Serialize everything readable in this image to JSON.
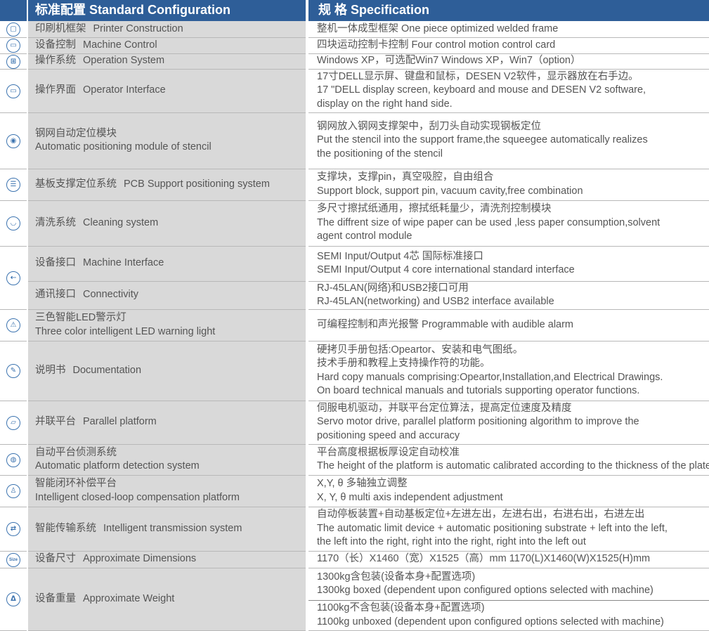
{
  "header": {
    "left": "标准配置  Standard Configuration",
    "right": "规  格  Specification"
  },
  "rows": [
    {
      "icon": "frame-icon",
      "glyph": "▢",
      "zh": "印刷机框架",
      "en": "Printer Construction",
      "spec": [
        "整机一体成型框架   One piece optimized welded frame"
      ]
    },
    {
      "icon": "laptop-icon",
      "glyph": "▭",
      "zh": "设备控制",
      "en": "Machine Control",
      "spec": [
        "四块运动控制卡控制   Four control motion control card"
      ]
    },
    {
      "icon": "windows-icon",
      "glyph": "⊞",
      "zh": "操作系统",
      "en": "Operation System",
      "spec": [
        "Windows XP，可选配Win7   Windows XP，Win7（option）"
      ]
    },
    {
      "icon": "monitor-icon",
      "glyph": "▭",
      "zh": "操作界面",
      "en": "Operator Interface",
      "spec": [
        "17寸DELL显示屏、键盘和鼠标，DESEN V2软件，显示器放在右手边。",
        "17 \"DELL display screen, keyboard and mouse and DESEN V2 software,",
        "display on the right hand side."
      ]
    },
    {
      "icon": "location-pin-icon",
      "glyph": "◉",
      "zh": "钢网自动定位模块",
      "en": "Automatic positioning module of stencil",
      "twoline": true,
      "spec": [
        "钢网放入钢网支撑架中，刮刀头自动实现钢板定位",
        "Put the stencil into the support frame,the squeegee automatically realizes",
        "the positioning of the stencil"
      ]
    },
    {
      "icon": "support-icon",
      "glyph": "☰",
      "zh": "基板支撑定位系统",
      "en": "PCB Support positioning system",
      "spec": [
        "支撑块，支撑pin，真空吸腔，自由组合",
        "Support block, support pin, vacuum cavity,free combination"
      ]
    },
    {
      "icon": "cleaning-icon",
      "glyph": "◡",
      "zh": "清洗系统",
      "en": "Cleaning system",
      "spec": [
        "多尺寸擦拭纸通用，擦拭纸耗量少，清洗剂控制模块",
        "The diffrent size of wipe paper can be used ,less paper consumption,solvent",
        "agent control module"
      ]
    },
    {
      "icon": "usb-icon",
      "glyph": "⇠",
      "zh": "设备接口",
      "en": "Machine Interface",
      "spec": [
        "SEMI  Input/Output 4芯 国际标准接口",
        "SEMI Input/Output 4 core international standard interface"
      ]
    },
    {
      "zh": "通讯接口",
      "en": "Connectivity",
      "spec": [
        "RJ-45LAN(网络)和USB2接口可用",
        "RJ-45LAN(networking) and USB2 interface available"
      ]
    },
    {
      "icon": "warning-icon",
      "glyph": "⚠",
      "zh": "三色智能LED警示灯",
      "en": "Three color intelligent LED warning light",
      "twoline": true,
      "spec": [
        "可编程控制和声光报警   Programmable with audible alarm"
      ]
    },
    {
      "icon": "manual-icon",
      "glyph": "✎",
      "zh": "说明书",
      "en": "Documentation",
      "spec": [
        "硬拷贝手册包括:Opeartor、安装和电气图纸。",
        "技术手册和教程上支持操作符的功能。",
        "Hard copy manuals comprising:Opeartor,Installation,and Electrical Drawings.",
        "On board technical manuals and tutorials supporting operator functions."
      ]
    },
    {
      "icon": "platform-icon",
      "glyph": "▱",
      "zh": "并联平台",
      "en": "Parallel platform",
      "spec": [
        "伺服电机驱动，并联平台定位算法，提高定位速度及精度",
        "Servo motor drive, parallel platform positioning algorithm to improve the",
        "positioning speed and accuracy"
      ]
    },
    {
      "icon": "shield-icon",
      "glyph": "◍",
      "zh": "自动平台侦测系统",
      "en": "Automatic platform detection system",
      "twoline": true,
      "spec": [
        "平台高度根据板厚设定自动校准",
        "The height of the platform is automatic calibrated according to the thickness of the plate"
      ]
    },
    {
      "icon": "closed-loop-icon",
      "glyph": "♙",
      "zh": "智能闭环补偿平台",
      "en": "Intelligent closed-loop compensation platform",
      "twoline": true,
      "spec": [
        "X,Y, θ 多轴独立调整",
        "X, Y,  θ  multi axis independent adjustment"
      ]
    },
    {
      "icon": "transfer-icon",
      "glyph": "⇄",
      "zh": "智能传输系统",
      "en": "Intelligent transmission system",
      "spec": [
        "自动停板装置+自动基板定位+左进左出，左进右出，右进右出，右进左出",
        "The automatic limit device + automatic positioning substrate + left into the left,",
        "the left into the right, right into the right, right into the left out"
      ]
    },
    {
      "icon": "size-icon",
      "glyph": "Size",
      "zh": "设备尺寸",
      "en": "Approximate Dimensions",
      "spec": [
        "1170（长）X1460（宽）X1525（高）mm   1170(L)X1460(W)X1525(H)mm"
      ]
    },
    {
      "icon": "weight-icon",
      "glyph": "ᐃ",
      "zh": "设备重量",
      "en": "Approximate Weight",
      "spec": [
        "1300kg含包装(设备本身+配置选项)",
        "1300kg boxed (dependent upon configured options selected with machine)"
      ],
      "spec2": [
        "1100kg不含包装(设备本身+配置选项)",
        "1100kg unboxed (dependent upon configured options selected with machine)"
      ]
    }
  ]
}
